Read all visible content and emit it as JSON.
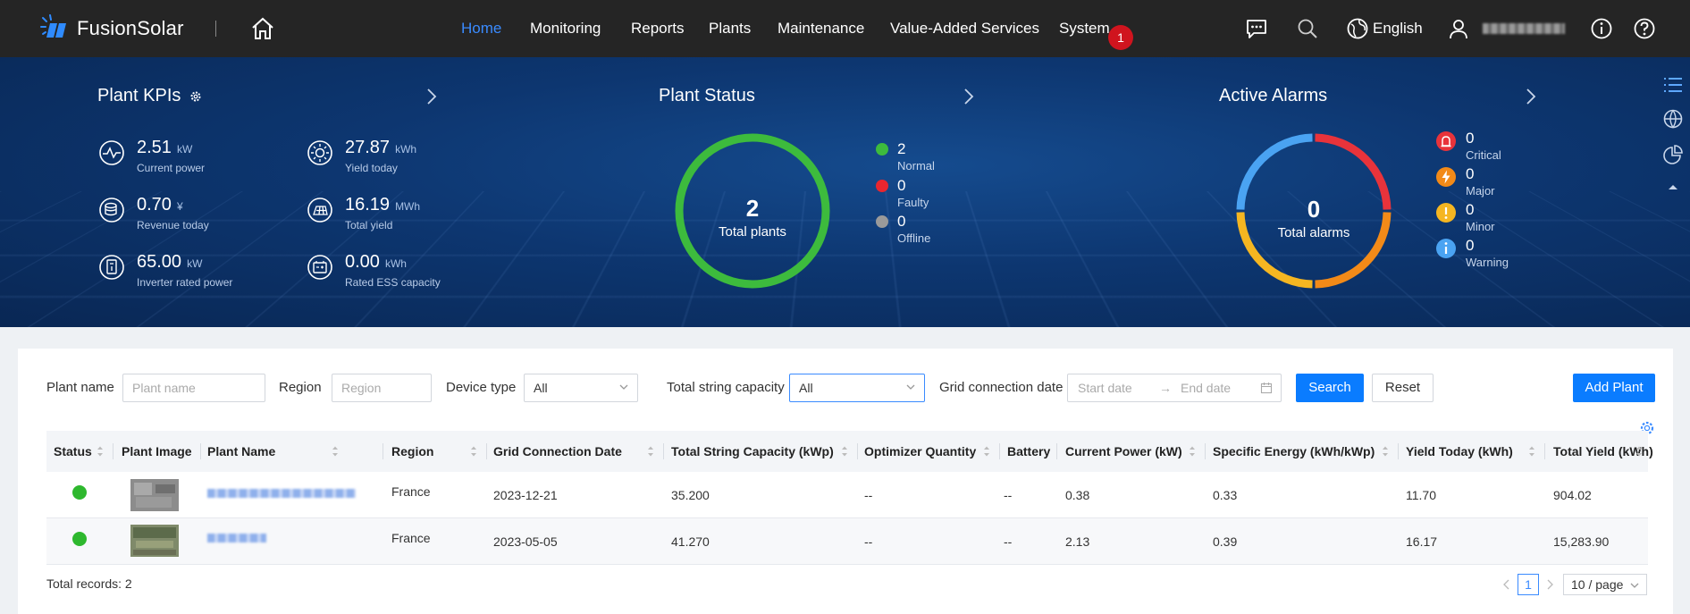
{
  "app": {
    "name": "FusionSolar"
  },
  "nav": {
    "items": [
      "Home",
      "Monitoring",
      "Reports",
      "Plants",
      "Maintenance",
      "Value-Added Services",
      "System"
    ],
    "system_badge": "1",
    "language": "English"
  },
  "kpis": {
    "title": "Plant KPIs",
    "items": [
      {
        "value": "2.51",
        "unit": "kW",
        "label": "Current power",
        "icon": "current-power-icon"
      },
      {
        "value": "27.87",
        "unit": "kWh",
        "label": "Yield today",
        "icon": "yield-today-icon"
      },
      {
        "value": "0.70",
        "unit": "¥",
        "label": "Revenue today",
        "icon": "revenue-icon"
      },
      {
        "value": "16.19",
        "unit": "MWh",
        "label": "Total yield",
        "icon": "total-yield-icon"
      },
      {
        "value": "65.00",
        "unit": "kW",
        "label": "Inverter rated power",
        "icon": "inverter-icon"
      },
      {
        "value": "0.00",
        "unit": "kWh",
        "label": "Rated ESS capacity",
        "icon": "ess-icon"
      }
    ]
  },
  "plant_status": {
    "title": "Plant Status",
    "total": "2",
    "total_label": "Total plants",
    "legend": [
      {
        "count": "2",
        "label": "Normal",
        "color": "#3dbb3d"
      },
      {
        "count": "0",
        "label": "Faulty",
        "color": "#e8262f"
      },
      {
        "count": "0",
        "label": "Offline",
        "color": "#9a9a9a"
      }
    ]
  },
  "alarms": {
    "title": "Active Alarms",
    "total": "0",
    "total_label": "Total alarms",
    "legend": [
      {
        "count": "0",
        "label": "Critical",
        "color": "#e8333b",
        "icon": "critical-alarm-icon"
      },
      {
        "count": "0",
        "label": "Major",
        "color": "#f28a18",
        "icon": "major-alarm-icon"
      },
      {
        "count": "0",
        "label": "Minor",
        "color": "#f5b621",
        "icon": "minor-alarm-icon"
      },
      {
        "count": "0",
        "label": "Warning",
        "color": "#4aa3f2",
        "icon": "warning-alarm-icon"
      }
    ]
  },
  "filters": {
    "plant_name_label": "Plant name",
    "plant_name_placeholder": "Plant name",
    "region_label": "Region",
    "region_placeholder": "Region",
    "device_type_label": "Device type",
    "device_type_value": "All",
    "capacity_label": "Total string capacity",
    "capacity_value": "All",
    "grid_date_label": "Grid connection date",
    "start_placeholder": "Start date",
    "end_placeholder": "End date",
    "search_label": "Search",
    "reset_label": "Reset",
    "add_label": "Add Plant"
  },
  "table": {
    "columns": [
      "Status",
      "Plant Image",
      "Plant Name",
      "Region",
      "Grid Connection Date",
      "Total String Capacity (kWp)",
      "Optimizer Quantity",
      "Battery",
      "Current Power (kW)",
      "Specific Energy (kWh/kWp)",
      "Yield Today (kWh)",
      "Total Yield (kWh)"
    ],
    "rows": [
      {
        "region": "France",
        "grid_date": "2023-12-21",
        "capacity": "35.200",
        "optimizer": "--",
        "battery": "--",
        "current_power": "0.38",
        "specific_energy": "0.33",
        "yield_today": "11.70",
        "total_yield": "904.02"
      },
      {
        "region": "France",
        "grid_date": "2023-05-05",
        "capacity": "41.270",
        "optimizer": "--",
        "battery": "--",
        "current_power": "2.13",
        "specific_energy": "0.39",
        "yield_today": "16.17",
        "total_yield": "15,283.90"
      }
    ]
  },
  "footer": {
    "total_records": "Total records: 2",
    "current_page": "1",
    "page_size": "10 / page"
  }
}
